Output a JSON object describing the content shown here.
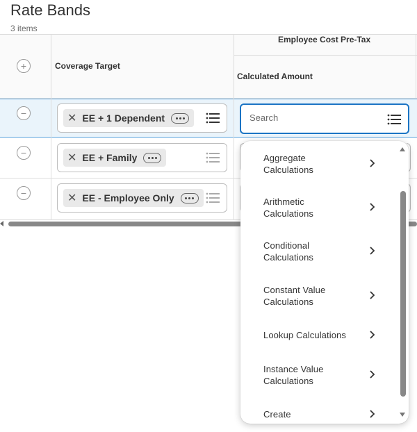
{
  "page": {
    "title": "Rate Bands",
    "item_count": "3 items"
  },
  "table": {
    "columns": {
      "coverage_target": "Coverage Target",
      "group_header": "Employee Cost Pre-Tax",
      "calculated_amount": "Calculated Amount"
    },
    "rows": [
      {
        "coverage": "EE + 1 Dependent",
        "selected": true
      },
      {
        "coverage": "EE + Family",
        "selected": false
      },
      {
        "coverage": "EE - Employee Only",
        "selected": false
      }
    ]
  },
  "search": {
    "placeholder": "Search"
  },
  "dropdown": {
    "items": [
      {
        "line1": "Aggregate",
        "line2": "Calculations"
      },
      {
        "line1": "Arithmetic",
        "line2": "Calculations"
      },
      {
        "line1": "Conditional",
        "line2": "Calculations"
      },
      {
        "line1": "Constant Value",
        "line2": "Calculations"
      },
      {
        "line1": "Lookup Calculations",
        "line2": ""
      },
      {
        "line1": "Instance Value",
        "line2": "Calculations"
      },
      {
        "line1": "Create",
        "line2": ""
      }
    ]
  },
  "icons": {
    "add": "plus-circle-icon",
    "remove": "minus-circle-icon",
    "clear": "x-icon",
    "more": "ellipsis-icon",
    "prompt": "list-icon",
    "submenu": "chevron-right-icon"
  },
  "colors": {
    "accent": "#1b74c4",
    "selected_row": "#eaf4fb"
  }
}
